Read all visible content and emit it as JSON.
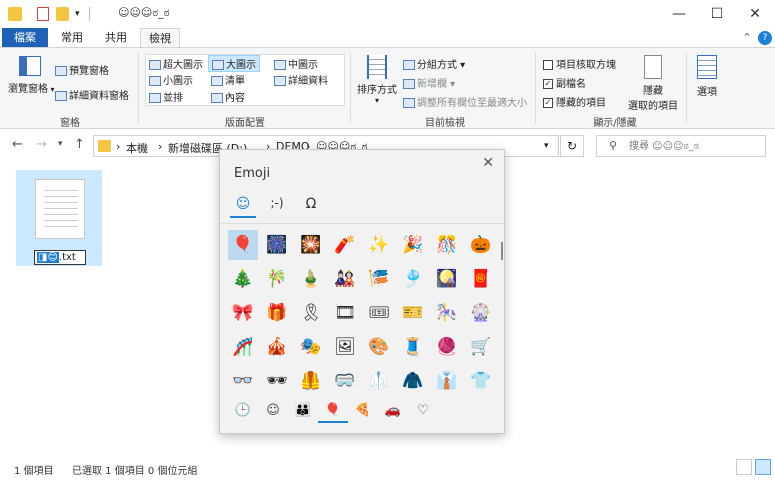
{
  "window": {
    "title": "☺☺☺ಠ_ಠ"
  },
  "tabs": [
    {
      "label": "檔案"
    },
    {
      "label": "常用"
    },
    {
      "label": "共用"
    },
    {
      "label": "檢視"
    }
  ],
  "ribbon": {
    "panes": {
      "nav_pane": "瀏覽窗格",
      "preview_pane": "預覽窗格",
      "details_pane": "詳細資料窗格",
      "group_label": "窗格"
    },
    "layout": {
      "items": [
        "超大圖示",
        "大圖示",
        "中圖示",
        "小圖示",
        "清單",
        "詳細資料",
        "並排",
        "內容"
      ],
      "group_label": "版面配置"
    },
    "current_view": {
      "sort_label": "排序方式",
      "group_by": "分組方式",
      "add_columns": "新增欄",
      "size_all": "調整所有欄位至最適大小",
      "group_label": "目前檢視"
    },
    "show_hide": {
      "item_checkboxes": "項目核取方塊",
      "file_ext": "副檔名",
      "hidden_items": "隱藏的項目",
      "hide_selected_1": "隱藏",
      "hide_selected_2": "選取的項目",
      "group_label": "顯示/隱藏"
    },
    "options": "選項"
  },
  "address": {
    "crumbs": [
      "本機",
      "新增磁碟區 (D:)",
      "DEMO",
      "☺☺☺ಠ_ಠ"
    ],
    "search_placeholder": "搜尋 ☺☺☺ಠ_ಠ"
  },
  "file": {
    "rename_ext": ".txt",
    "rename_emoji": "😊"
  },
  "status": {
    "count": "1 個項目",
    "selected": "已選取 1 個項目 0 個位元組"
  },
  "emoji_panel": {
    "title": "Emoji",
    "tabs": [
      "☺",
      ";-)",
      "Ω"
    ],
    "emojis": [
      [
        "🎈",
        "🎆",
        "🎇",
        "🧨",
        "✨",
        "🎉",
        "🎊",
        "🎃"
      ],
      [
        "🎄",
        "🎋",
        "🎍",
        "🎎",
        "🎏",
        "🎐",
        "🎑",
        "🧧"
      ],
      [
        "🎀",
        "🎁",
        "🎗",
        "🎞",
        "🎟",
        "🎫",
        "🎠",
        "🎡"
      ],
      [
        "🎢",
        "🎪",
        "🎭",
        "🖼",
        "🎨",
        "🧵",
        "🧶",
        "🛒"
      ],
      [
        "👓",
        "🕶",
        "🦺",
        "🥽",
        "🥼",
        "🧥",
        "👔",
        "👕"
      ]
    ],
    "categories": [
      "🕒",
      "☺",
      "👪",
      "🎈",
      "🍕",
      "🚗",
      "♡"
    ]
  }
}
